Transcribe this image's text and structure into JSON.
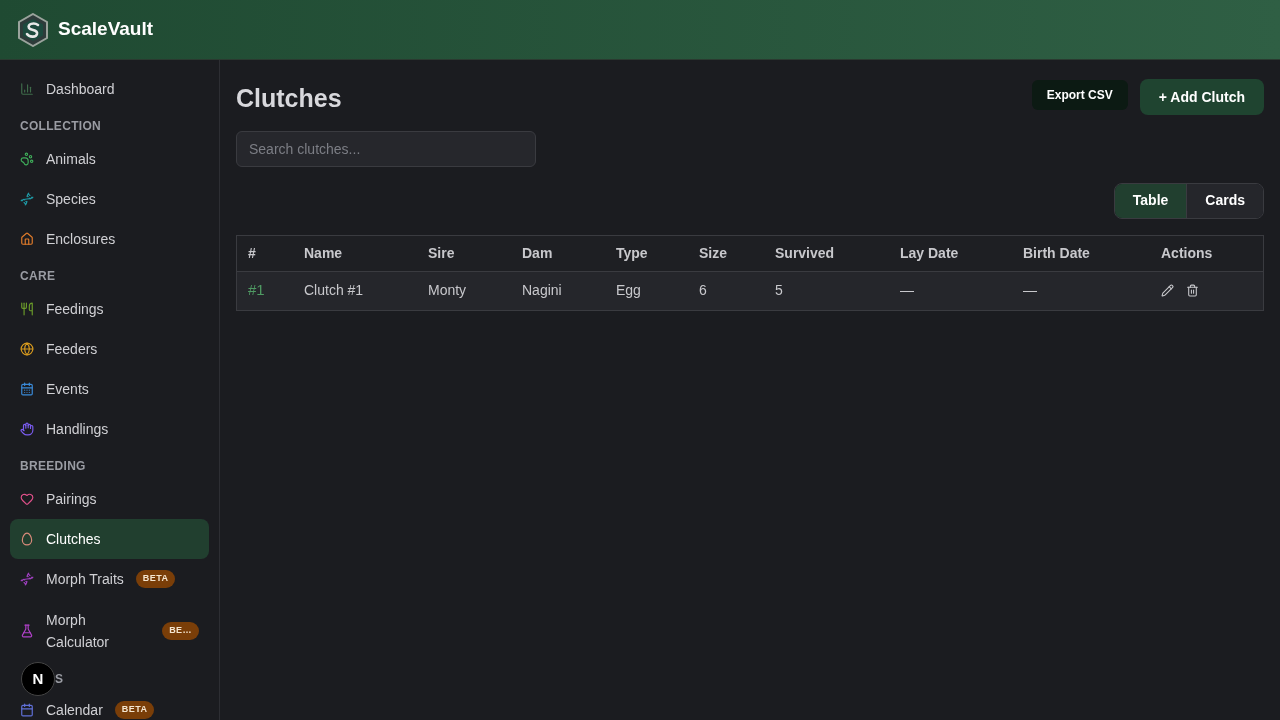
{
  "app": {
    "name": "ScaleVault"
  },
  "sidebar": {
    "sections": [
      {
        "items": [
          {
            "label": "Dashboard",
            "selected": false
          }
        ]
      },
      {
        "label": "COLLECTION",
        "items": [
          {
            "label": "Animals",
            "selected": false
          },
          {
            "label": "Species",
            "selected": false
          },
          {
            "label": "Enclosures",
            "selected": false
          }
        ]
      },
      {
        "label": "CARE",
        "items": [
          {
            "label": "Feedings",
            "selected": false
          },
          {
            "label": "Feeders",
            "selected": false
          },
          {
            "label": "Events",
            "selected": false
          },
          {
            "label": "Handlings",
            "selected": false
          }
        ]
      },
      {
        "label": "BREEDING",
        "items": [
          {
            "label": "Pairings",
            "selected": false
          },
          {
            "label": "Clutches",
            "selected": true
          },
          {
            "label": "Morph Traits",
            "selected": false,
            "badge": "BETA"
          },
          {
            "label": "Morph Calculator",
            "selected": false,
            "badge": "BE…"
          }
        ]
      },
      {
        "label": "S",
        "items": [
          {
            "label": "Calendar",
            "selected": false,
            "badge": "BETA"
          }
        ]
      }
    ]
  },
  "floating_button": {
    "label": "N"
  },
  "page": {
    "title": "Clutches",
    "buttons": [
      "Export CSV",
      "+ Add Clutch"
    ],
    "search": {
      "placeholder": "Search clutches..."
    },
    "view_toggle": [
      {
        "label": "Table",
        "selected": true
      },
      {
        "label": "Cards",
        "selected": false
      }
    ],
    "table": {
      "columns": [
        "#",
        "Name",
        "Sire",
        "Dam",
        "Type",
        "Size",
        "Survived",
        "Lay Date",
        "Birth Date",
        "Actions"
      ],
      "rows": [
        {
          "cells": [
            "#1",
            "Clutch #1",
            "Monty",
            "Nagini",
            "Egg",
            "6",
            "5",
            "—",
            "—"
          ]
        }
      ]
    }
  }
}
